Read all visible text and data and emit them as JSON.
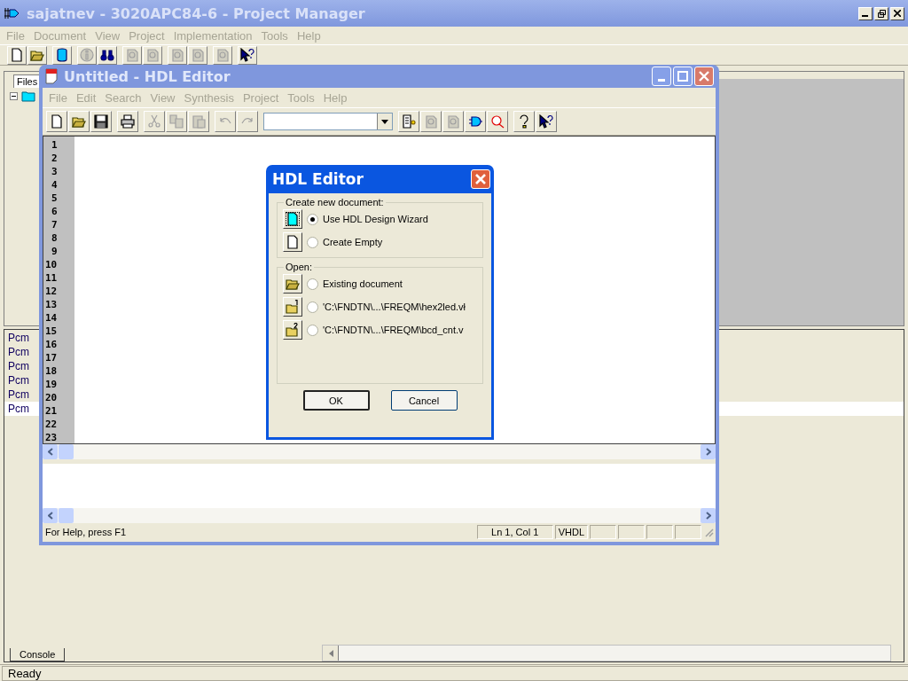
{
  "main_window": {
    "title": "sajatnev - 3020APC84-6 - Project Manager",
    "menu": [
      "File",
      "Document",
      "View",
      "Project",
      "Implementation",
      "Tools",
      "Help"
    ],
    "toolbar": [
      [
        {
          "kind": "new",
          "disabled": false
        },
        {
          "kind": "open",
          "disabled": false
        }
      ],
      [
        {
          "kind": "database",
          "disabled": false
        }
      ],
      [
        {
          "kind": "info",
          "disabled": true
        },
        {
          "kind": "find",
          "disabled": false
        }
      ],
      [
        {
          "kind": "generic",
          "disabled": true
        },
        {
          "kind": "generic",
          "disabled": true
        }
      ],
      [
        {
          "kind": "generic",
          "disabled": true
        },
        {
          "kind": "generic",
          "disabled": true
        }
      ],
      [
        {
          "kind": "generic",
          "disabled": true
        }
      ],
      [
        {
          "kind": "whatsthis",
          "disabled": false
        }
      ]
    ],
    "files_tab": {
      "label": "Files",
      "selected": true
    },
    "console_lines": [
      {
        "text": "Pcm",
        "selected": false
      },
      {
        "text": "Pcm",
        "selected": false
      },
      {
        "text": "Pcm",
        "selected": false
      },
      {
        "text": "Pcm",
        "selected": false
      },
      {
        "text": "Pcm",
        "selected": false
      },
      {
        "text": "Pcm",
        "selected": true
      }
    ],
    "console_tab": {
      "label": "Console",
      "selected": true
    },
    "status_bar": "Ready"
  },
  "editor_window": {
    "title": "Untitled - HDL Editor",
    "menu": [
      "File",
      "Edit",
      "Search",
      "View",
      "Synthesis",
      "Project",
      "Tools",
      "Help"
    ],
    "toolbar": [
      [
        {
          "kind": "new",
          "disabled": false
        },
        {
          "kind": "open",
          "disabled": false
        },
        {
          "kind": "save",
          "disabled": false
        }
      ],
      [
        {
          "kind": "print",
          "disabled": false
        }
      ],
      [
        {
          "kind": "cut",
          "disabled": true
        },
        {
          "kind": "copy",
          "disabled": true
        },
        {
          "kind": "paste",
          "disabled": true
        }
      ],
      [
        {
          "kind": "undo",
          "disabled": true
        },
        {
          "kind": "redo",
          "disabled": true
        }
      ],
      [
        {
          "kind": "combo",
          "disabled": false
        }
      ],
      [
        {
          "kind": "list",
          "disabled": false
        },
        {
          "kind": "generic",
          "disabled": true
        },
        {
          "kind": "generic",
          "disabled": true
        },
        {
          "kind": "gate",
          "disabled": false
        },
        {
          "kind": "zoom",
          "disabled": false
        }
      ],
      [
        {
          "kind": "help",
          "disabled": false
        },
        {
          "kind": "whatsthis",
          "disabled": false
        }
      ]
    ],
    "line_numbers": [
      "1",
      "2",
      "3",
      "4",
      "5",
      "6",
      "7",
      "8",
      "9",
      "10",
      "11",
      "12",
      "13",
      "14",
      "15",
      "16",
      "17",
      "18",
      "19",
      "20",
      "21",
      "22",
      "23"
    ],
    "status_bar": {
      "help": "For Help, press F1",
      "position": "Ln 1, Col 1",
      "language": "VHDL"
    }
  },
  "dialog": {
    "title": "HDL Editor",
    "groups": [
      {
        "label": "Create new document:",
        "options": [
          {
            "kind": "wizard",
            "label": "Use HDL Design Wizard",
            "selected": true
          },
          {
            "kind": "new",
            "label": "Create Empty",
            "selected": false
          }
        ]
      },
      {
        "label": "Open:",
        "options": [
          {
            "kind": "open",
            "label": "Existing document",
            "selected": false
          },
          {
            "kind": "recent1",
            "label": "'C:\\FNDTN\\...\\FREQM\\hex2led.vł",
            "selected": false
          },
          {
            "kind": "recent2",
            "label": "'C:\\FNDTN\\...\\FREQM\\bcd_cnt.v",
            "selected": false
          }
        ]
      }
    ],
    "buttons": [
      "OK",
      "Cancel"
    ]
  }
}
